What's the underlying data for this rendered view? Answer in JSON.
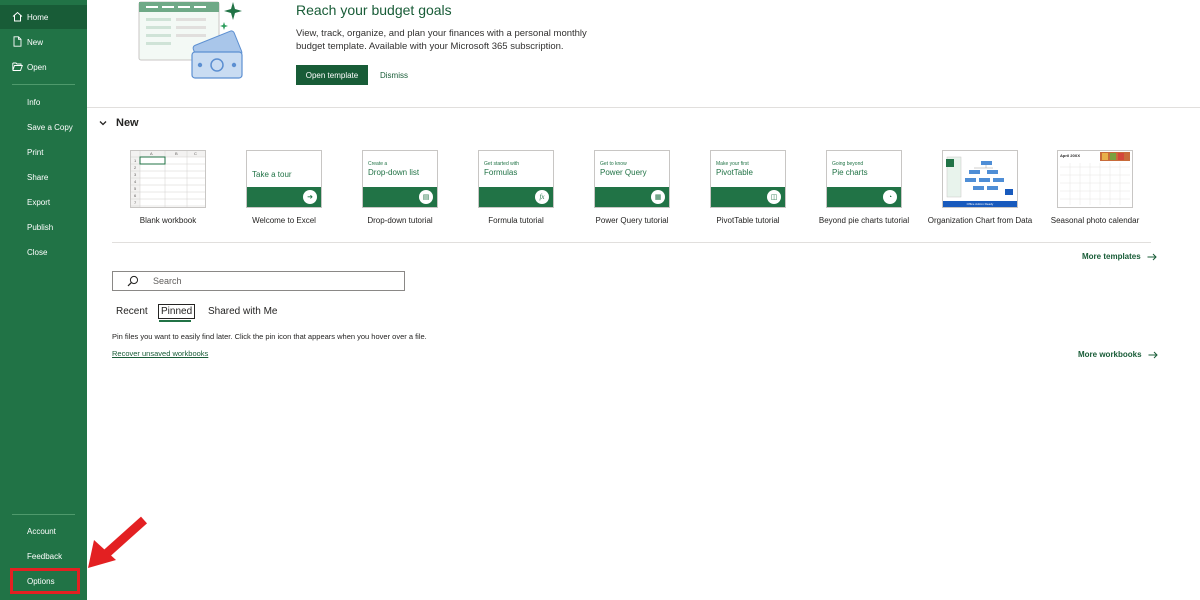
{
  "sidebar": {
    "items": [
      {
        "label": "Home",
        "icon": "home-icon"
      },
      {
        "label": "New",
        "icon": "new-file-icon"
      },
      {
        "label": "Open",
        "icon": "folder-open-icon"
      },
      {
        "label": "Info"
      },
      {
        "label": "Save a Copy"
      },
      {
        "label": "Print"
      },
      {
        "label": "Share"
      },
      {
        "label": "Export"
      },
      {
        "label": "Publish"
      },
      {
        "label": "Close"
      },
      {
        "label": "Account"
      },
      {
        "label": "Feedback"
      },
      {
        "label": "Options"
      }
    ],
    "active_item": "Home"
  },
  "banner": {
    "title": "Reach your budget goals",
    "description": "View, track, organize, and plan your finances with a personal monthly budget template. Available with your Microsoft 365 subscription.",
    "open_button": "Open template",
    "dismiss_button": "Dismiss"
  },
  "new_section": {
    "header": "New",
    "templates": [
      {
        "caption": "Blank workbook",
        "kind": "blank"
      },
      {
        "caption": "Welcome to Excel",
        "kind": "tour",
        "thumb_text": "Take a tour"
      },
      {
        "caption": "Drop-down tutorial",
        "kind": "tutorial",
        "thumb_small": "Create a",
        "thumb_big": "Drop-down list"
      },
      {
        "caption": "Formula tutorial",
        "kind": "tutorial",
        "thumb_small": "Get started with",
        "thumb_big": "Formulas"
      },
      {
        "caption": "Power Query tutorial",
        "kind": "tutorial",
        "thumb_small": "Get to know",
        "thumb_big": "Power Query"
      },
      {
        "caption": "PivotTable tutorial",
        "kind": "tutorial",
        "thumb_small": "Make your first",
        "thumb_big": "PivotTable"
      },
      {
        "caption": "Beyond pie charts tutorial",
        "kind": "tutorial",
        "thumb_small": "Going beyond",
        "thumb_big": "Pie charts"
      },
      {
        "caption": "Organization Chart from Data",
        "kind": "orgchart",
        "thumb_footer": "Office Add-in Ready"
      },
      {
        "caption": "Seasonal photo calendar",
        "kind": "calendar",
        "thumb_small": "April 20XX"
      }
    ],
    "blank_sheet": {
      "columns": [
        "A",
        "B",
        "C"
      ],
      "rows": [
        "1",
        "2",
        "3",
        "4",
        "5",
        "6",
        "7"
      ]
    },
    "more_templates": "More templates"
  },
  "files": {
    "search_placeholder": "Search",
    "tabs": [
      "Recent",
      "Pinned",
      "Shared with Me"
    ],
    "active_tab": "Pinned",
    "pinned_message": "Pin files you want to easily find later. Click the pin icon that appears when you hover over a file.",
    "recover_link": "Recover unsaved workbooks",
    "more_workbooks": "More workbooks"
  },
  "colors": {
    "brand_green": "#217346",
    "dark_green": "#185c37",
    "highlight_red": "#e32022"
  }
}
